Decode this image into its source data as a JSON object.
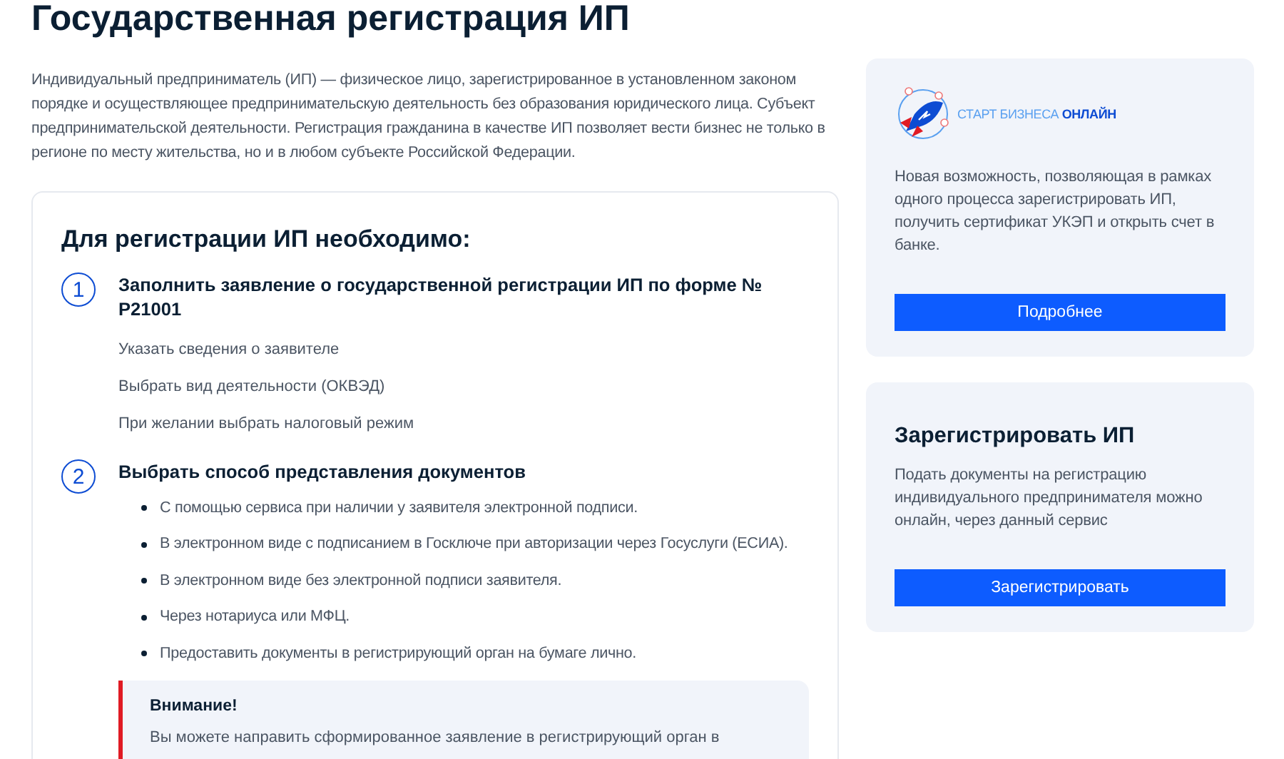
{
  "title": "Государственная регистрация ИП",
  "intro": "Индивидуальный предприниматель (ИП) — физическое лицо, зарегистрированное в установленном законом порядке и осуществляющее предпринимательскую деятельность без образования юридического лица. Субъект предпринимательской деятельности. Регистрация гражданина в качестве ИП позволяет вести бизнес не только в регионе по месту жительства, но и в любом субъекте Российской Федерации.",
  "steps_card": {
    "heading": "Для регистрации ИП необходимо:",
    "steps": [
      {
        "number": "1",
        "title": "Заполнить заявление о государственной регистрации ИП по форме № Р21001",
        "kind": "plain",
        "items": [
          "Указать сведения о заявителе",
          "Выбрать вид деятельности (ОКВЭД)",
          "При желании выбрать налоговый режим"
        ]
      },
      {
        "number": "2",
        "title": "Выбрать способ представления документов",
        "kind": "bullets",
        "items": [
          "С помощью сервиса при наличии у заявителя электронной подписи.",
          "В электронном виде с подписанием в Госключе при авторизации через Госуслуги (ЕСИА).",
          "В электронном виде без электронной подписи заявителя.",
          "Через нотариуса или МФЦ.",
          "Предоставить документы в регистрирующий орган на бумаге лично."
        ],
        "notice": {
          "title": "Внимание!",
          "text": "Вы можете направить сформированное заявление в регистрирующий орган в"
        }
      }
    ]
  },
  "sidebar": [
    {
      "kind": "promo",
      "logo_text": "СТАРТ БИЗНЕСА **ОНЛАЙН**",
      "text": "Новая возможность, позволяющая в рамках одного процесса зарегистрировать ИП, получить сертификат УКЭП и открыть счет в банке.",
      "button": "Подробнее"
    },
    {
      "kind": "action",
      "heading": "Зарегистрировать ИП",
      "text": "Подать документы на регистрацию индивидуального предпринимателя можно онлайн, через данный сервис",
      "button": "Зарегистрировать"
    }
  ]
}
